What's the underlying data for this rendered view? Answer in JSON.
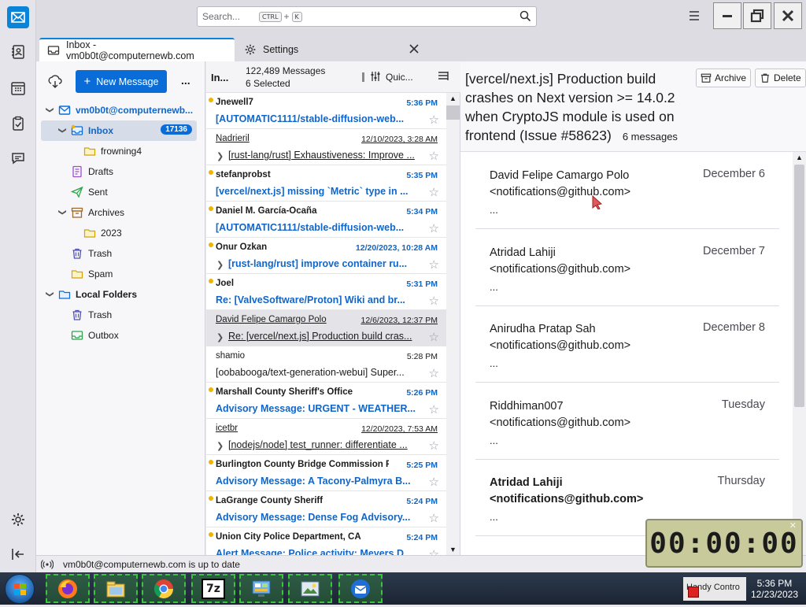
{
  "search": {
    "placeholder": "Search...",
    "shortcut_mod": "CTRL",
    "shortcut_plus": "+",
    "shortcut_key": "K"
  },
  "tabs": [
    {
      "label": "Inbox - vm0b0t@computernewb.com"
    },
    {
      "label": "Settings"
    }
  ],
  "folder_pane": {
    "new_message": "New Message",
    "more": "...",
    "account": "vm0b0t@computernewb...",
    "folders": [
      {
        "label": "Inbox",
        "badge": "17136"
      },
      {
        "label": "frowning4"
      },
      {
        "label": "Drafts"
      },
      {
        "label": "Sent"
      },
      {
        "label": "Archives"
      },
      {
        "label": "2023"
      },
      {
        "label": "Trash"
      },
      {
        "label": "Spam"
      }
    ],
    "local_folders": "Local Folders",
    "local": [
      {
        "label": "Trash"
      },
      {
        "label": "Outbox"
      }
    ]
  },
  "thread_pane": {
    "folder_short": "In...",
    "count": "122,489 Messages",
    "selected": "6 Selected",
    "quick_filter": "Quic...",
    "messages": [
      {
        "sender": "Jnewell7",
        "date": "5:36 PM",
        "subject": "[AUTOMATIC1111/stable-diffusion-web...",
        "unread": true
      },
      {
        "sender": "Nadrieril",
        "date": "12/10/2023, 3:28 AM",
        "subject": "[rust-lang/rust] Exhaustiveness: Improve ...",
        "thread": true
      },
      {
        "sender": "stefanprobst",
        "date": "5:35 PM",
        "subject": "[vercel/next.js] missing `Metric` type in ...",
        "unread": true
      },
      {
        "sender": "Daniel M. García-Ocaña",
        "date": "5:34 PM",
        "subject": "[AUTOMATIC1111/stable-diffusion-web...",
        "unread": true
      },
      {
        "sender": "Onur Özkan",
        "date": "12/20/2023, 10:28 AM",
        "subject": "[rust-lang/rust] improve container ru...",
        "unread": true,
        "threaded": true
      },
      {
        "sender": "Joel",
        "date": "5:31 PM",
        "subject": "Re: [ValveSoftware/Proton] Wiki and br...",
        "unread": true
      },
      {
        "sender": "David Felipe Camargo Polo",
        "date": "12/6/2023, 12:37 PM",
        "subject": "Re: [vercel/next.js] Production build cras...",
        "thread": true,
        "selected": true
      },
      {
        "sender": "shamio",
        "date": "5:28 PM",
        "subject": "[oobabooga/text-generation-webui] Super..."
      },
      {
        "sender": "Marshall County Sheriff's Office",
        "date": "5:26 PM",
        "subject": "Advisory Message: URGENT - WEATHER...",
        "unread": true
      },
      {
        "sender": "icetbr",
        "date": "12/20/2023, 7:53 AM",
        "subject": "[nodejs/node] test_runner: differentiate ...",
        "thread": true
      },
      {
        "sender": "Burlington County Bridge Commission P...",
        "date": "5:25 PM",
        "subject": "Advisory Message: A Tacony-Palmyra B...",
        "unread": true
      },
      {
        "sender": "LaGrange County Sheriff",
        "date": "5:24 PM",
        "subject": "Advisory Message: Dense Fog Advisory...",
        "unread": true
      },
      {
        "sender": "Union City Police Department, CA",
        "date": "5:24 PM",
        "subject": "Alert Message: Police activity: Meyers D...",
        "unread": true
      }
    ]
  },
  "reading_pane": {
    "subject": "[vercel/next.js] Production build crashes on Next version >= 14.0.2 when CryptoJS module is used on frontend (Issue #58623)",
    "message_count": "6 messages",
    "archive": "Archive",
    "delete": "Delete",
    "cards": [
      {
        "name": "David Felipe Camargo Polo <notifications@github.com>",
        "date": "December 6",
        "dots": "..."
      },
      {
        "name": "Atridad Lahiji <notifications@github.com>",
        "date": "December 7",
        "dots": "..."
      },
      {
        "name": "Anirudha Pratap Sah <notifications@github.com>",
        "date": "December 8",
        "dots": "..."
      },
      {
        "name": "Riddhiman007 <notifications@github.com>",
        "date": "Tuesday",
        "dots": "..."
      },
      {
        "name": "Atridad Lahiji <notifications@github.com>",
        "date": "Thursday",
        "dots": "...",
        "bold": true
      }
    ]
  },
  "status": {
    "text": "vm0b0t@computernewb.com is up to date"
  },
  "timer": {
    "display": "00:00:00"
  },
  "tray": {
    "time": "5:36 PM",
    "date": "12/23/2023",
    "obscured": "Handy Contro"
  },
  "colors": {
    "accent": "#0a6dd7",
    "unread_blue": "#1166c8",
    "unread_dot": "#f0b400"
  }
}
